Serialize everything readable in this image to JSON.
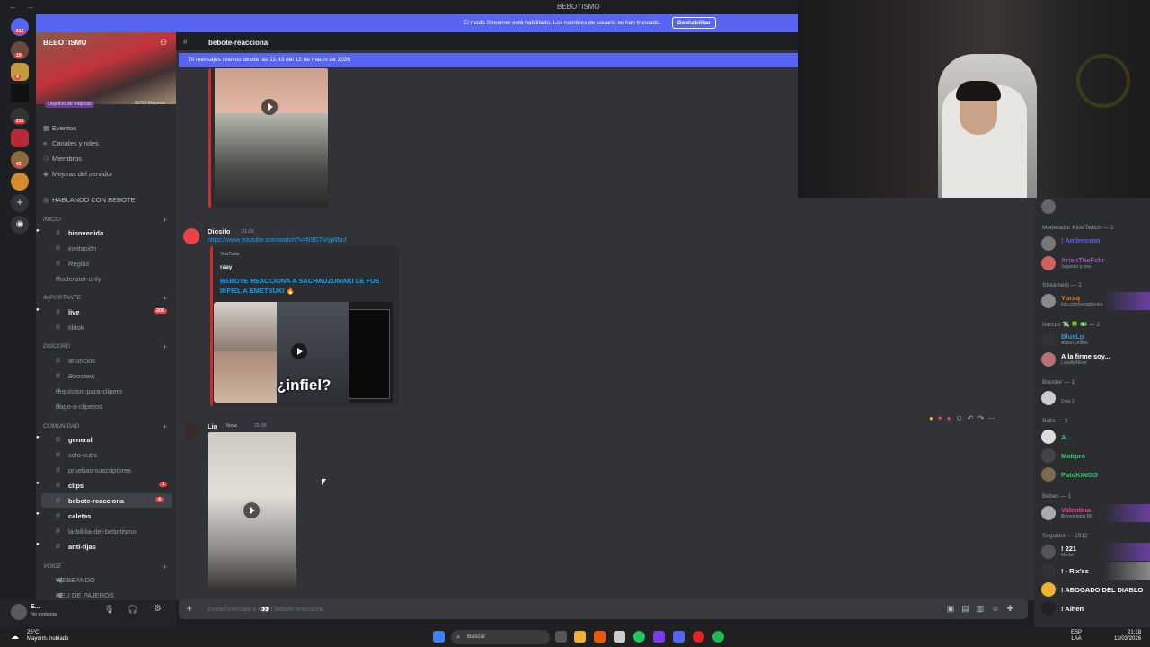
{
  "window": {
    "title": "BEBOTISMO"
  },
  "streamer_bar": {
    "text": "El modo Streamer está habilitado. Los nombres de usuario se han truncado.",
    "button": "Deshabilitar"
  },
  "rail_badges": [
    "612",
    "19",
    "4",
    "210",
    "42"
  ],
  "guild": {
    "name": "BEBOTISMO",
    "boost_goal": "Objetivo de mejoras",
    "boost_count": "11/33 Mejoras"
  },
  "menu": [
    "Eventos",
    "Canales y roles",
    "Miembros",
    "Mejoras del servidor",
    "HABLANDO CON BEBOTE"
  ],
  "categories": {
    "inicio": "INICIO",
    "importante": "IMPORTANTE",
    "discord": "DISCORD",
    "comunidad": "COMUNIDAD",
    "voice": "VOICE"
  },
  "channels": {
    "bienvenida": "bienvenida",
    "invitacion": "invitación",
    "reglas": "Reglas",
    "moderator": "moderator-only",
    "live": "live",
    "live_badge": "206",
    "tiktok": "tiktok",
    "anuncios": "anuncios",
    "boosters": "Boosters",
    "requisitos": "requisitos-para-clipero",
    "pago": "pago-a-cliperos",
    "general": "general",
    "solo_subs": "solo-subs",
    "pruebas": "pruebas-suscriptores",
    "clips": "clips",
    "clips_badge": "1",
    "bebote": "bebote-reacciona",
    "bebote_badge": "4",
    "caletas": "caletas",
    "biblia": "la-biblia-del-bebotismo",
    "antifijas": "anti-fijas",
    "webeando": "WEBEANDO",
    "reu": "REU DE PAJEROS"
  },
  "user_panel": {
    "name": "E...",
    "status": "No molestar"
  },
  "header": {
    "channel": "bebote-reacciona"
  },
  "new_messages": "70 mensajes nuevos desde las 22:43 del 12 de marzo de 2026",
  "messages": {
    "m1": {
      "author": "Diosito",
      "time": "21:05",
      "link": "https://www.youtube.com/watch?v=N9GTVqjWbuI",
      "embed_provider": "YouTube",
      "embed_author": "raay",
      "embed_title": "BEBOTE REACCIONA A SACHAUZUMAKI LE FUE INFIEL A EMETSUKI 🔥",
      "thumb_text": "¿infiel?"
    },
    "m2": {
      "author": "Lia",
      "tag": "Nova",
      "time": "21:05"
    }
  },
  "input": {
    "placeholder": "Enviar mensaje a #👀 | bebote-reacciona"
  },
  "members": {
    "roles": {
      "mod": "Moderador Kick/Twitch — 2",
      "streamers": "Streamers — 1",
      "narcos": "Narcos 💸 🍀 💵 — 2",
      "booster": "Booster — 1",
      "subs": "Subs — 3",
      "bebes": "Bebes — 1",
      "seguidor": "Seguidor — 1912"
    },
    "list": [
      {
        "name": "! Andersson",
        "status": "",
        "color": "#5865f2"
      },
      {
        "name": "ArianTheFckr",
        "status": "Jugando a una",
        "color": "#9b59b6"
      },
      {
        "name": "Yuraq",
        "status": "tiok.com/yuraqhenka",
        "color": "#e67e22"
      },
      {
        "name": "BlueLp",
        "status": "Albion Online",
        "color": "#3498db"
      },
      {
        "name": "A la firme soy...",
        "status": "Loyalty4Ever",
        "color": "#ffffff"
      },
      {
        "name": "",
        "status": "Dota 2",
        "color": "#9b59b6"
      },
      {
        "name": "A...",
        "status": "",
        "color": "#2ecc71"
      },
      {
        "name": "Matipro",
        "status": "",
        "color": "#2ecc71"
      },
      {
        "name": "PatoKINGG",
        "status": "",
        "color": "#2ecc71"
      },
      {
        "name": "Valentina",
        "status": "Bienvenidos RP",
        "color": "#eb459e"
      },
      {
        "name": "! 221",
        "status": "Medal",
        "color": "#ffffff"
      },
      {
        "name": "! - Rix'ss",
        "status": "",
        "color": "#ffffff"
      },
      {
        "name": "! ABOGADO DEL DIABLO",
        "status": "",
        "color": "#ffffff"
      },
      {
        "name": "! Aihen",
        "status": "",
        "color": "#ffffff"
      }
    ]
  },
  "taskbar": {
    "temp": "25°C",
    "weather": "Mayorm. nublado",
    "search": "Buscar",
    "lang1": "ESP",
    "lang2": "LAA",
    "time": "21:18",
    "date": "13/03/2026"
  }
}
